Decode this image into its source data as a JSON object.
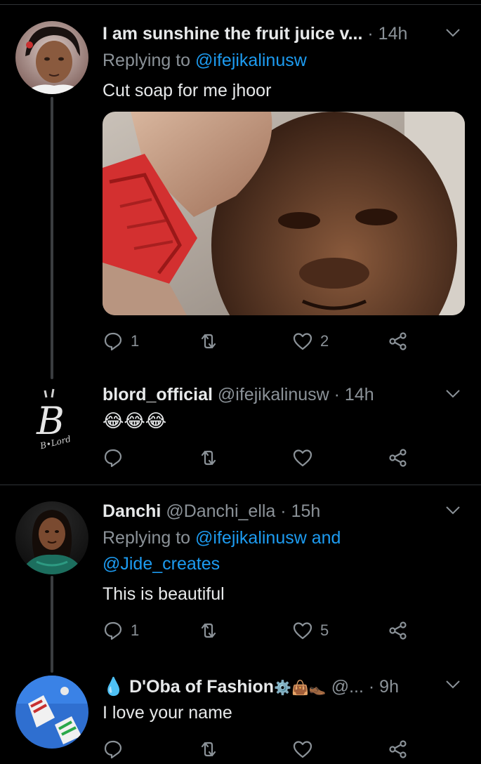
{
  "tweets": [
    {
      "name": "I am sunshine the fruit juice v...",
      "handle": "",
      "time": "· 14h",
      "replying_prefix": "Replying to",
      "replying_to": "@ifejikalinusw",
      "replying_to_2": "",
      "text": "Cut soap for me jhoor",
      "reply_count": "1",
      "retweet_count": "",
      "like_count": "2"
    },
    {
      "name": "blord_official",
      "handle": "@ifejikalinusw",
      "time": "· 14h",
      "text": "😂😂😂",
      "avatar_logo": "B",
      "avatar_logo_sub": "B•Lord",
      "reply_count": "",
      "retweet_count": "",
      "like_count": ""
    },
    {
      "name": "Danchi",
      "handle": "@Danchi_ella",
      "time": "· 15h",
      "replying_prefix": "Replying to",
      "replying_to": "@ifejikalinusw and",
      "replying_to_2": "@Jide_creates",
      "text": "This is beautiful",
      "reply_count": "1",
      "retweet_count": "",
      "like_count": "5"
    },
    {
      "name_prefix": "💧",
      "name": "D'Oba of Fashion",
      "name_suffix": "⚙️👜👞",
      "handle": "@...",
      "time": "· 9h",
      "text": "I love your name",
      "reply_count": "",
      "retweet_count": "",
      "like_count": ""
    }
  ],
  "icons": {
    "reply": "reply-icon",
    "retweet": "retweet-icon",
    "like": "heart-icon",
    "share": "share-icon",
    "more": "chevron-down-icon"
  },
  "colors": {
    "background": "#000000",
    "link": "#1d9bf0",
    "muted": "#8b9298",
    "text": "#e7e9ea"
  }
}
